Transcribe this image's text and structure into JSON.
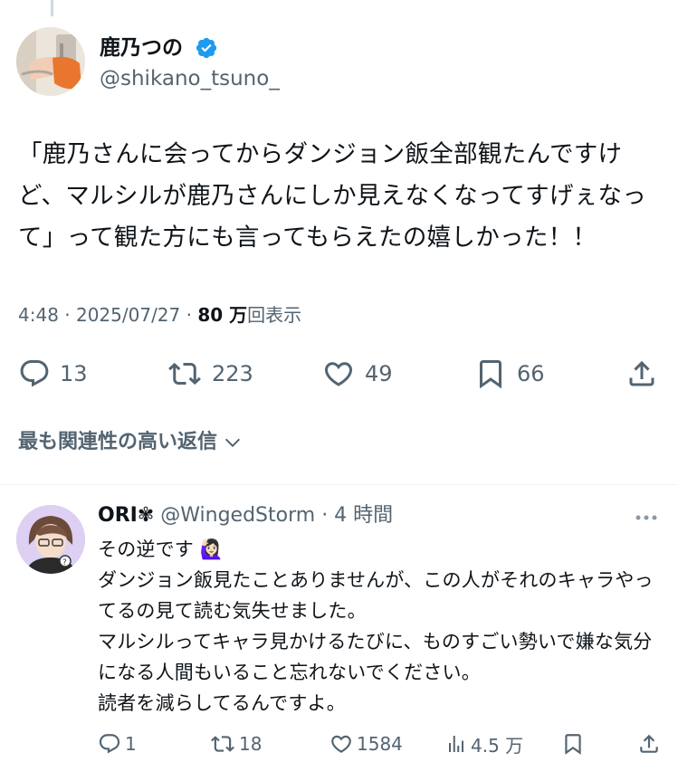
{
  "tweet": {
    "author_name": "鹿乃つの",
    "author_handle": "@shikano_tsuno_",
    "text": "「鹿乃さんに会ってからダンジョン飯全部観たんですけど、マルシルが鹿乃さんにしか見えなくなってすげぇなって」って観た方にも言ってもらえたの嬉しかった！！",
    "time": "4:48 · 2025/07/27 · ",
    "views_count": "80 万",
    "views_label": "回表示",
    "stats": {
      "replies": "13",
      "reposts": "223",
      "likes": "49",
      "bookmarks": "66"
    }
  },
  "sort_label": "最も関連性の高い返信",
  "reply": {
    "author_name": "ORI✾",
    "author_handle": "@WingedStorm",
    "time": " · 4 時間",
    "text": "その逆です 🙋🏻‍♀️\nダンジョン飯見たことありませんが、この人がそれのキャラやってるの見て読む気失せました。\nマルシルってキャラ見かけるたびに、ものすごい勢いで嫌な気分になる人間もいること忘れないでください。\n読者を減らしてるんですよ。",
    "stats": {
      "replies": "1",
      "reposts": "18",
      "likes": "1584",
      "views": "4.5 万"
    }
  },
  "colors": {
    "accent": "#1d9bf0",
    "text": "#0f1419",
    "secondary": "#536471"
  }
}
